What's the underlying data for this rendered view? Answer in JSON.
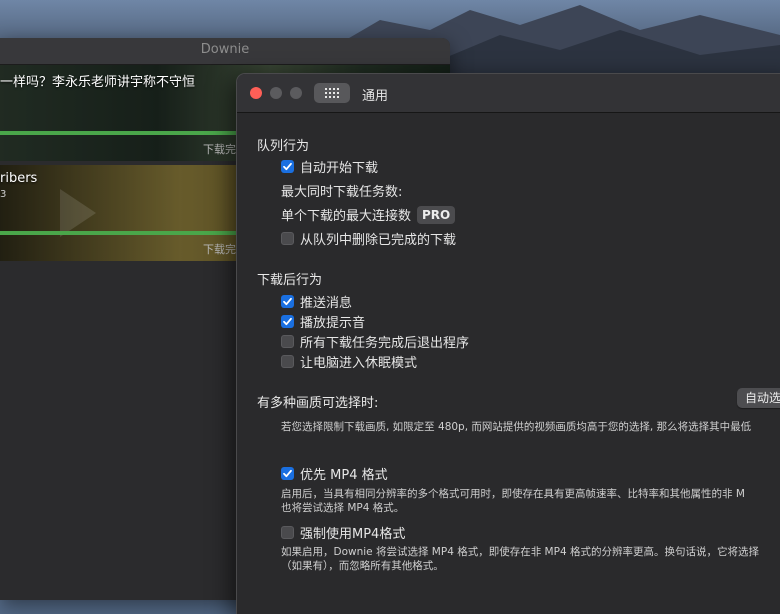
{
  "colors": {
    "accent": "#1a6fe0",
    "progress": "#4aa64a",
    "close": "#fe5f57"
  },
  "downie": {
    "title": "Downie",
    "items": [
      {
        "title": "一样吗？李永乐老师讲宇称不守恒",
        "sub": "",
        "status": "下载完成",
        "progress": 1.0
      },
      {
        "title": "ribers",
        "sub": "3",
        "status": "下载完成",
        "progress": 1.0
      }
    ]
  },
  "prefs": {
    "title": "通用",
    "queue": {
      "heading": "队列行为",
      "auto_start": {
        "label": "自动开始下载",
        "checked": true
      },
      "max_concurrent": "最大同时下载任务数:",
      "max_connections": "单个下载的最大连接数",
      "pro_badge": "PRO",
      "remove_completed": {
        "label": "从队列中删除已完成的下载",
        "checked": false
      }
    },
    "after": {
      "heading": "下载后行为",
      "notify": {
        "label": "推送消息",
        "checked": true
      },
      "sound": {
        "label": "播放提示音",
        "checked": true
      },
      "quit": {
        "label": "所有下载任务完成后退出程序",
        "checked": false
      },
      "sleep": {
        "label": "让电脑进入休眠模式",
        "checked": false
      }
    },
    "quality": {
      "heading": "有多种画质可选择时:",
      "select_value": "自动选",
      "desc": "若您选择限制下载画质, 如限定至 480p, 而网站提供的视频画质均高于您的选择, 那么将选择其中最低",
      "prefer_mp4": {
        "label": "优先 MP4 格式",
        "checked": true
      },
      "prefer_desc_1": "启用后，当具有相同分辨率的多个格式可用时，即使存在具有更高帧速率、比特率和其他属性的非 M",
      "prefer_desc_2": "也将尝试选择 MP4 格式。",
      "force_mp4": {
        "label": "强制使用MP4格式",
        "checked": false
      },
      "force_desc_1": "如果启用，Downie 将尝试选择 MP4 格式，即使存在非 MP4 格式的分辨率更高。换句话说，它将选择",
      "force_desc_2": "（如果有），而忽略所有其他格式。"
    }
  }
}
